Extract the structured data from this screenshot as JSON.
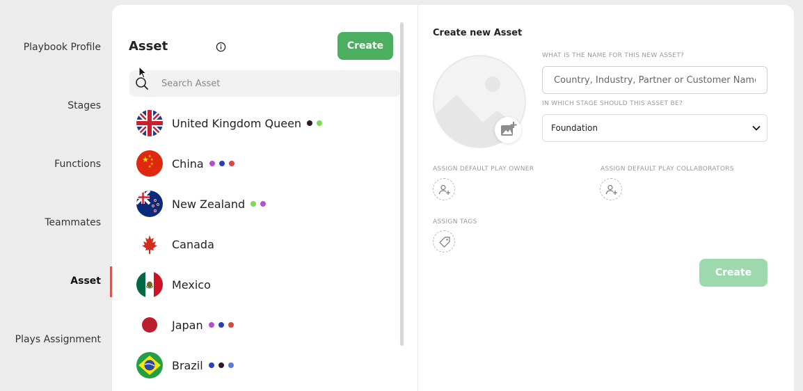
{
  "nav": {
    "items": [
      {
        "label": "Playbook Profile",
        "active": false
      },
      {
        "label": "Stages",
        "active": false
      },
      {
        "label": "Functions",
        "active": false
      },
      {
        "label": "Teammates",
        "active": false
      },
      {
        "label": "Asset",
        "active": true
      },
      {
        "label": "Plays Assignment",
        "active": false
      }
    ]
  },
  "asset_panel": {
    "title": "Asset",
    "create_label": "Create",
    "search_placeholder": "Search Asset",
    "assets": [
      {
        "name": "United Kingdom Queen",
        "flag": "uk-flag-icon",
        "dots": [
          "#2a1a2a",
          "#7ed957"
        ]
      },
      {
        "name": "China",
        "flag": "china-flag-icon",
        "dots": [
          "#b44fd1",
          "#2a3fbf",
          "#d9453f"
        ]
      },
      {
        "name": "New Zealand",
        "flag": "new-zealand-flag-icon",
        "dots": [
          "#7ed957",
          "#b44fd1"
        ]
      },
      {
        "name": "Canada",
        "flag": "canada-flag-icon",
        "dots": []
      },
      {
        "name": "Mexico",
        "flag": "mexico-flag-icon",
        "dots": []
      },
      {
        "name": "Japan",
        "flag": "japan-flag-icon",
        "dots": [
          "#b44fd1",
          "#2a3fbf",
          "#d9453f"
        ]
      },
      {
        "name": "Brazil",
        "flag": "brazil-flag-icon",
        "dots": [
          "#2a3fbf",
          "#2a1a2a",
          "#5b7bd6"
        ]
      }
    ]
  },
  "form": {
    "title": "Create new Asset",
    "name_label": "WHAT IS THE NAME FOR THIS NEW ASSET?",
    "name_placeholder": "Country, Industry, Partner or Customer Name",
    "stage_label": "IN WHICH STAGE SHOULD THIS ASSET BE?",
    "stage_value": "Foundation",
    "owner_label": "ASSIGN DEFAULT PLAY OWNER",
    "collaborators_label": "ASSIGN DEFAULT PLAY COLLABORATORS",
    "tags_label": "ASSIGN TAGS",
    "create_label": "Create"
  },
  "colors": {
    "primary_green": "#4caf5f",
    "disabled_green": "#9ed9ad",
    "active_indicator": "#d9534f"
  }
}
